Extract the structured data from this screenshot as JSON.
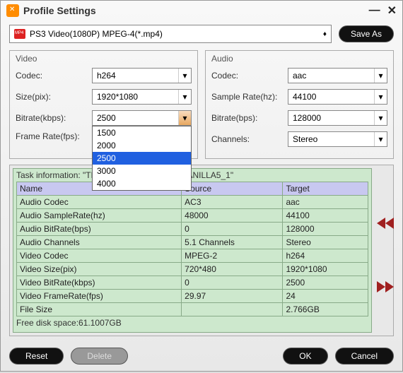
{
  "title": "Profile Settings",
  "profile_value": "PS3 Video(1080P) MPEG-4(*.mp4)",
  "saveas_label": "Save As",
  "video": {
    "legend": "Video",
    "codec_label": "Codec:",
    "codec_value": "h264",
    "size_label": "Size(pix):",
    "size_value": "1920*1080",
    "bitrate_label": "Bitrate(kbps):",
    "bitrate_value": "2500",
    "bitrate_options": [
      "1500",
      "2000",
      "2500",
      "3000",
      "4000"
    ],
    "framerate_label": "Frame Rate(fps):"
  },
  "audio": {
    "legend": "Audio",
    "codec_label": "Codec:",
    "codec_value": "aac",
    "samplerate_label": "Sample Rate(hz):",
    "samplerate_value": "44100",
    "bitrate_label": "Bitrate(bps):",
    "bitrate_value": "128000",
    "channels_label": "Channels:",
    "channels_value": "Stereo"
  },
  "task": {
    "title": "Task information: \"TRANSFORMERS2_D1_VANILLA5_1\"",
    "headers": [
      "Name",
      "Source",
      "Target"
    ],
    "rows": [
      [
        "Audio Codec",
        "AC3",
        "aac"
      ],
      [
        "Audio SampleRate(hz)",
        "48000",
        "44100"
      ],
      [
        "Audio BitRate(bps)",
        "0",
        "128000"
      ],
      [
        "Audio Channels",
        "5.1 Channels",
        "Stereo"
      ],
      [
        "Video Codec",
        "MPEG-2",
        "h264"
      ],
      [
        "Video Size(pix)",
        "720*480",
        "1920*1080"
      ],
      [
        "Video BitRate(kbps)",
        "0",
        "2500"
      ],
      [
        "Video FrameRate(fps)",
        "29.97",
        "24"
      ],
      [
        "File Size",
        "",
        "2.766GB"
      ]
    ],
    "free_space": "Free disk space:61.1007GB"
  },
  "footer": {
    "reset": "Reset",
    "delete": "Delete",
    "ok": "OK",
    "cancel": "Cancel"
  }
}
